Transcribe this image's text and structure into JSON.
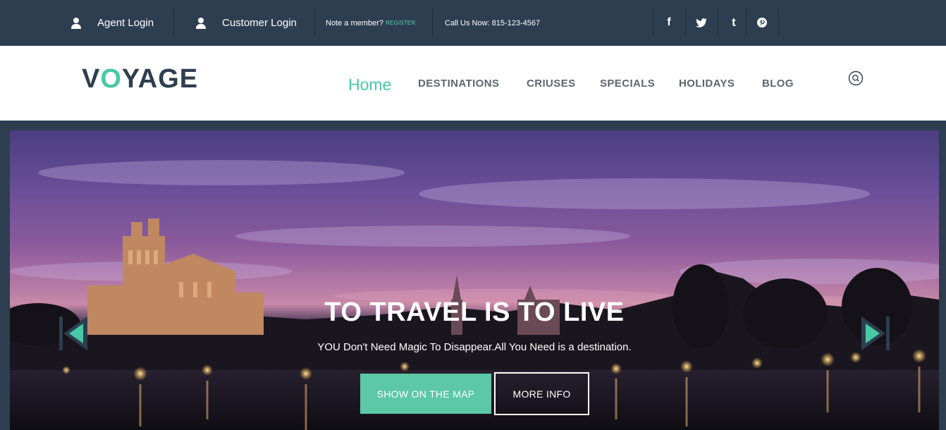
{
  "topbar": {
    "agent_login": "Agent Login",
    "customer_login": "Customer Login",
    "member_text": "Note a member?",
    "register_label": "REGISTER",
    "call_text": "Call Us Now: 815-123-4567",
    "social": {
      "facebook": "f",
      "twitter": "twitter-icon",
      "tumblr": "t",
      "pinterest": "pinterest-icon"
    }
  },
  "header": {
    "logo_pre": "V",
    "logo_o": "O",
    "logo_post": "YAGE",
    "nav": {
      "home": "Home",
      "destinations": "DESTINATIONS",
      "cruises": "CRIUSES",
      "specials": "SPECIALS",
      "holidays": "HOLIDAYS",
      "blog": "BLOG"
    },
    "search_icon": "search-icon"
  },
  "hero": {
    "title": "TO TRAVEL IS TO LIVE",
    "subtitle": "YOU Don't Need Magic To Disappear.All You Need is a destination.",
    "primary_button": "SHOW ON THE MAP",
    "secondary_button": "MORE INFO",
    "prev_icon": "prev-arrow-icon",
    "next_icon": "next-arrow-icon"
  },
  "colors": {
    "navy": "#2d3e50",
    "accent": "#48c9a5",
    "button": "#5cc8a5"
  }
}
